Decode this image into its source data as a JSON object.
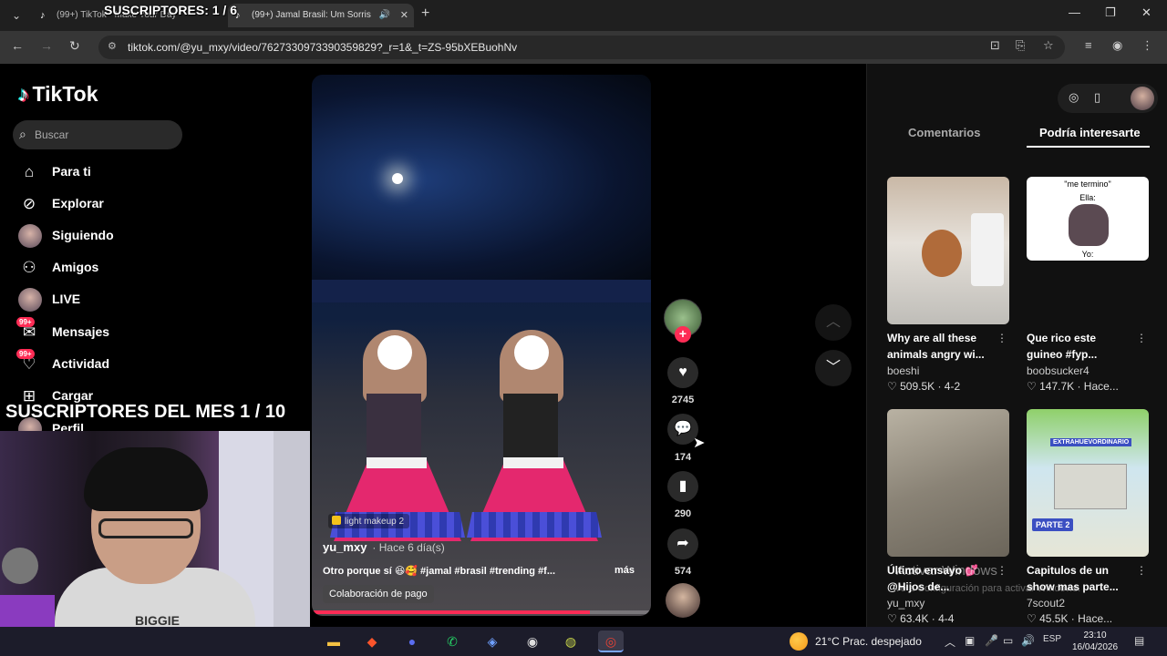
{
  "browser": {
    "tabs": [
      {
        "label": "(99+) TikTok - Make Your Day",
        "active": false
      },
      {
        "label": "(99+) Jamal Brasil: Um Sorris",
        "active": true
      }
    ],
    "url": "tiktok.com/@yu_mxy/video/7627330973390359829?_r=1&_t=ZS-95bXEBuohNv"
  },
  "overlays": {
    "top": "SUSCRIPTORES: 1 / 6",
    "mid": "SUSCRIPTORES DEL MES 1 / 10"
  },
  "sidebar": {
    "logo": "TikTok",
    "search_placeholder": "Buscar",
    "items": [
      {
        "label": "Para ti",
        "icon": "home-icon"
      },
      {
        "label": "Explorar",
        "icon": "compass-icon"
      },
      {
        "label": "Siguiendo",
        "icon": "following-avatar"
      },
      {
        "label": "Amigos",
        "icon": "friends-icon"
      },
      {
        "label": "LIVE",
        "icon": "live-avatar"
      },
      {
        "label": "Mensajes",
        "icon": "messages-icon",
        "badge": "99+"
      },
      {
        "label": "Actividad",
        "icon": "activity-icon",
        "badge": "99+"
      },
      {
        "label": "Cargar",
        "icon": "upload-icon"
      },
      {
        "label": "Perfil",
        "icon": "profile-avatar"
      }
    ]
  },
  "webcam": {
    "shirt_text": "BIGGIE"
  },
  "video": {
    "label": "light makeup 2",
    "username": "yu_mxy",
    "time": "· Hace 6 día(s)",
    "description": "Otro porque sí 😆🥰 #jamal #brasil #trending #f...",
    "more": "más",
    "collab": "Colaboración de pago",
    "progress": 0.82
  },
  "actions": {
    "likes": "2745",
    "comments": "174",
    "saves": "290",
    "shares": "574"
  },
  "right_panel": {
    "tabs": [
      "Comentarios",
      "Podría interesarte"
    ],
    "active_tab": 1,
    "cards": [
      {
        "title": "Why are all these animals angry wi...",
        "user": "boeshi",
        "stats": "♡ 509.5K · 4-2"
      },
      {
        "title": "Que rico este guineo #fyp...",
        "user": "boobsucker4",
        "stats": "♡ 147.7K · Hace...",
        "thumb_text_1": "\"me termino\"",
        "thumb_text_2": "Ella:",
        "thumb_text_3": "Yo:"
      },
      {
        "title": "Último ensayo 💕 @Hijos de...",
        "user": "yu_mxy",
        "stats": "♡ 63.4K · 4-4"
      },
      {
        "title": "Capitulos de un show mas parte...",
        "user": "7scout2",
        "stats": "♡ 45.5K · Hace...",
        "thumb_tag": "PARTE 2",
        "thumb_top": "EXTRAHUEVORDINARIO"
      }
    ],
    "watermark": "Activar Windows",
    "watermark_sub": "Ve a Configuración para activar Windows."
  },
  "taskbar": {
    "weather": "21°C  Prac. despejado",
    "lang": "ESP",
    "time": "23:10",
    "date": "16/04/2026"
  },
  "colors": {
    "accent": "#fe2c55",
    "cyan": "#25f4ee",
    "bg": "#000000"
  }
}
